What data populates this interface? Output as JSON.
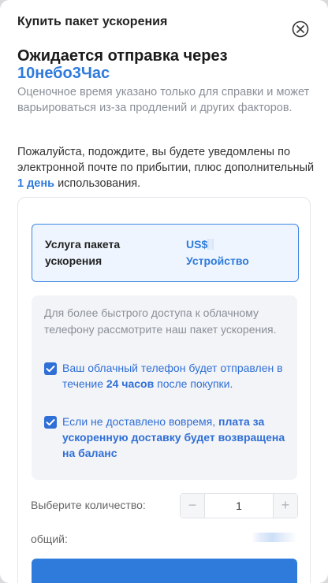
{
  "header": {
    "title": "Купить пакет ускорения",
    "close_icon": "close-circle-icon"
  },
  "headline": {
    "text": "Ожидается отправка через",
    "eta": "10небо3Час"
  },
  "note": "Оценочное время указано только для справки и может варьироваться из-за продлений и других факторов.",
  "wait": {
    "before": "Пожалуйста, подождите, вы будете уведомлены по электронной почте по прибытии, плюс дополнительный ",
    "highlight": "1 день",
    "after": " использования."
  },
  "service": {
    "label": "Услуга пакета ускорения",
    "price_prefix": "US$",
    "unit": "Устройство"
  },
  "info": {
    "text": "Для более быстрого доступа к облачному телефону рассмотрите наш пакет ускорения.",
    "check1": {
      "before": "Ваш облачный телефон будет отправлен в течение ",
      "bold": "24 часов",
      "after": " после покупки.",
      "checked": true
    },
    "check2": {
      "before": "Если не доставлено вовремя, ",
      "bold": "плата за ускоренную доставку будет возвращена на баланс",
      "checked": true
    }
  },
  "quantity": {
    "label": "Выберите количество:",
    "minus": "−",
    "value": "1",
    "plus": "+"
  },
  "total": {
    "label": "общий:"
  },
  "colors": {
    "accent": "#2f7bdc",
    "checkbox": "#2f6fd6",
    "overlay": "#d9dadd"
  }
}
